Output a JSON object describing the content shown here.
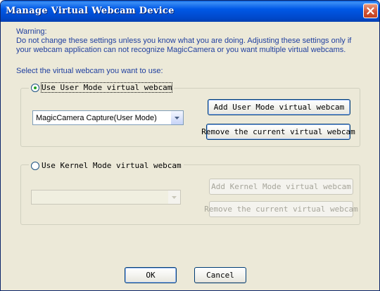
{
  "window": {
    "title": "Manage Virtual Webcam Device",
    "close_label": "✕"
  },
  "warning": {
    "heading": "Warning:",
    "body": "Do not change these settings unless you know what you are doing. Adjusting these settings only if your webcam application can not recognize MagicCamera or you want multiple virtual webcams."
  },
  "select_label": "Select the virtual webcam you want to use:",
  "user_mode": {
    "label": "Use User Mode virtual webcam",
    "selected": true,
    "combo_value": "MagicCamera Capture(User Mode)",
    "add_label": "Add User Mode virtual webcam",
    "remove_label": "Remove the current virtual webcam"
  },
  "kernel_mode": {
    "label": "Use Kernel Mode virtual webcam",
    "selected": false,
    "combo_value": "",
    "add_label": "Add Kernel Mode virtual webcam",
    "remove_label": "Remove the current virtual webcam"
  },
  "footer": {
    "ok_label": "OK",
    "cancel_label": "Cancel"
  },
  "colors": {
    "title_bar": "#0058e6",
    "dialog_bg": "#ece9d8",
    "label_text": "#1f3f9f",
    "close_button": "#d15335",
    "radio_dot": "#21a121"
  }
}
